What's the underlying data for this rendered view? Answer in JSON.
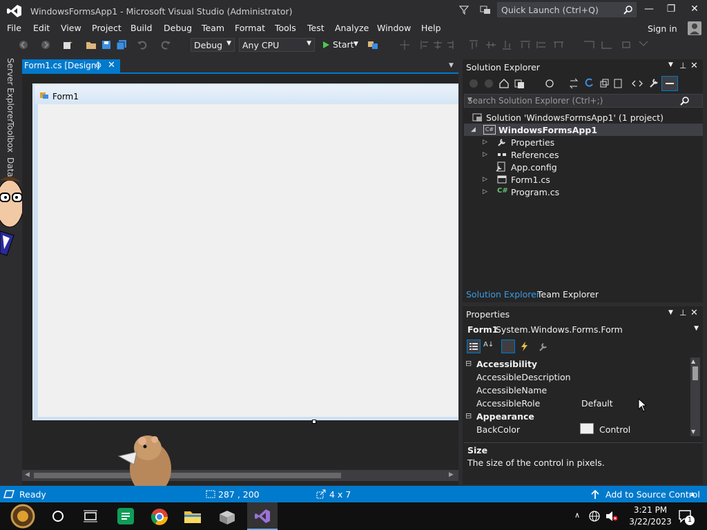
{
  "window": {
    "title": "WindowsFormsApp1 - Microsoft Visual Studio  (Administrator)"
  },
  "quick_launch": {
    "placeholder": "Quick Launch (Ctrl+Q)"
  },
  "menu": [
    "File",
    "Edit",
    "View",
    "Project",
    "Build",
    "Debug",
    "Team",
    "Format",
    "Tools",
    "Test",
    "Analyze",
    "Window",
    "Help"
  ],
  "sign_in": "Sign in",
  "toolbar": {
    "config": "Debug",
    "platform": "Any CPU",
    "start": "Start"
  },
  "left_rail": [
    "Server Explorer",
    "Toolbox",
    "Data"
  ],
  "document_tab": {
    "label": "Form1.cs [Design]"
  },
  "form": {
    "caption": "Form1"
  },
  "solution_explorer": {
    "title": "Solution Explorer",
    "search_placeholder": "Search Solution Explorer (Ctrl+;)",
    "solution": "Solution 'WindowsFormsApp1' (1 project)",
    "project": "WindowsFormsApp1",
    "items": [
      "Properties",
      "References",
      "App.config",
      "Form1.cs",
      "Program.cs"
    ],
    "tabs": [
      "Solution Explorer",
      "Team Explorer"
    ]
  },
  "properties": {
    "title": "Properties",
    "object": "Form1",
    "object_type": "System.Windows.Forms.Form",
    "rows": [
      {
        "kind": "category",
        "name": "Accessibility"
      },
      {
        "kind": "prop",
        "name": "AccessibleDescription",
        "value": ""
      },
      {
        "kind": "prop",
        "name": "AccessibleName",
        "value": ""
      },
      {
        "kind": "prop",
        "name": "AccessibleRole",
        "value": "Default"
      },
      {
        "kind": "category",
        "name": "Appearance"
      },
      {
        "kind": "prop",
        "name": "BackColor",
        "value": "Control"
      }
    ],
    "desc_title": "Size",
    "desc_text": "The size of the control in pixels."
  },
  "status": {
    "state": "Ready",
    "position": "287 , 200",
    "size": "4 x 7",
    "source_control": "Add to Source Control"
  },
  "clock": {
    "time": "3:21 PM",
    "date": "3/22/2023"
  },
  "notification_count": "1",
  "colors": {
    "accent": "#007acc",
    "bg": "#2d2d30",
    "panel": "#252526"
  }
}
